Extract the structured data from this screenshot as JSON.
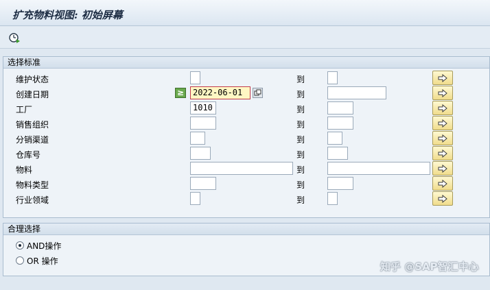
{
  "window": {
    "title": "扩充物料视图: 初始屏幕"
  },
  "toolbar": {
    "execute_icon": "clock-execute-icon"
  },
  "selection": {
    "title": "选择标准",
    "to_label": "到",
    "rows": [
      {
        "label": "维护状态",
        "from": "",
        "to": ""
      },
      {
        "label": "创建日期",
        "from": "2022-06-01",
        "to": "",
        "operator": "≥"
      },
      {
        "label": "工厂",
        "from": "1010",
        "to": ""
      },
      {
        "label": "销售组织",
        "from": "",
        "to": ""
      },
      {
        "label": "分销渠道",
        "from": "",
        "to": ""
      },
      {
        "label": "仓库号",
        "from": "",
        "to": ""
      },
      {
        "label": "物料",
        "from": "",
        "to": ""
      },
      {
        "label": "物料类型",
        "from": "",
        "to": ""
      },
      {
        "label": "行业领域",
        "from": "",
        "to": ""
      }
    ]
  },
  "logic": {
    "title": "合理选择",
    "and_label": "AND操作",
    "or_label": "OR 操作"
  },
  "colors": {
    "accent": "#c23a4a",
    "multi_button": "#f0dc8c"
  },
  "watermark": {
    "text": "知乎 @SAP智汇中心"
  }
}
